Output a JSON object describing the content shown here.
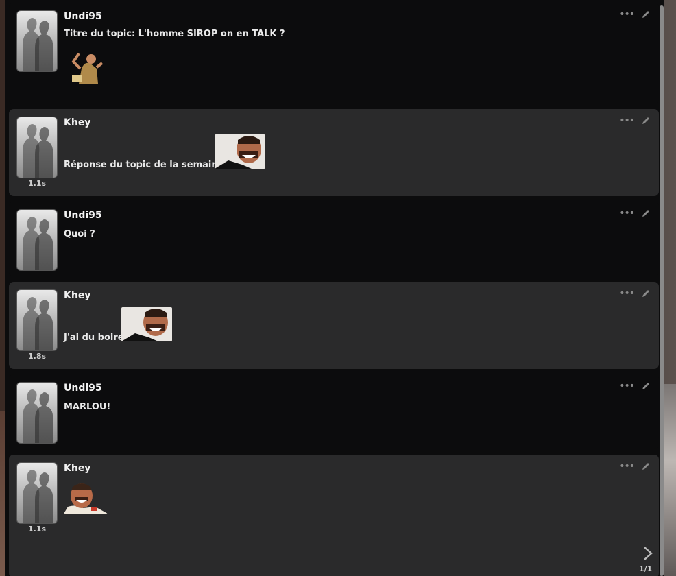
{
  "messages": [
    {
      "username": "Undi95",
      "text": "Titre du topic: L'homme SIROP on en TALK ?",
      "time": "",
      "sticker": "dancing-man-sticker"
    },
    {
      "username": "Khey",
      "text": "Réponse du topic de la semaine",
      "time": "1.1s",
      "sticker": "laughing-man-sticker"
    },
    {
      "username": "Undi95",
      "text": "Quoi ?",
      "time": ""
    },
    {
      "username": "Khey",
      "text": "J'ai du boire",
      "time": "1.8s",
      "sticker": "laughing-man-sticker"
    },
    {
      "username": "Undi95",
      "text": "MARLOU!",
      "time": ""
    },
    {
      "username": "Khey",
      "text": "",
      "time": "1.1s",
      "sticker": "laughing-man-sticker"
    }
  ],
  "pagination": {
    "label": "1/1"
  },
  "icons": {
    "more": "ellipsis-icon",
    "edit": "pencil-icon",
    "next": "chevron-right-icon"
  },
  "colors": {
    "panel": "#0c0c0d",
    "message_alt": "#2a2a2b",
    "text": "#eaeaea"
  }
}
